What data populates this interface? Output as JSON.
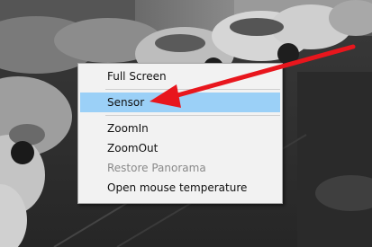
{
  "context_menu": {
    "items": [
      {
        "label": "Full Screen",
        "state": "normal"
      },
      {
        "label": "Sensor",
        "state": "highlighted"
      },
      {
        "label": "ZoomIn",
        "state": "normal"
      },
      {
        "label": "ZoomOut",
        "state": "normal"
      },
      {
        "label": "Restore Panorama",
        "state": "disabled"
      },
      {
        "label": "Open mouse temperature",
        "state": "normal"
      }
    ]
  },
  "colors": {
    "highlight": "#9bd0f7",
    "annotation_arrow": "#e8161d",
    "menu_background": "#f2f2f2"
  },
  "background": {
    "description_icon": "grayscale-parking-lot-camera-feed"
  }
}
